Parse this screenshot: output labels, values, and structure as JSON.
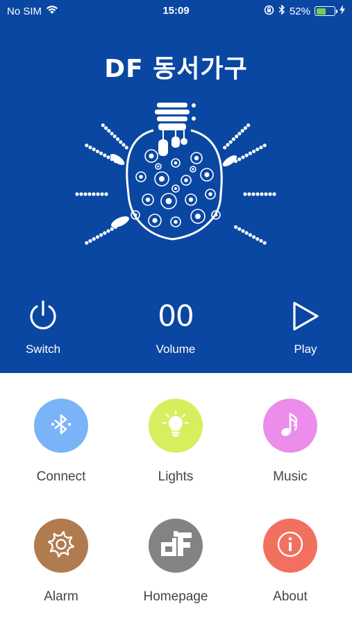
{
  "status_bar": {
    "carrier": "No SIM",
    "time": "15:09",
    "battery_percent": "52%",
    "battery_level": 0.52,
    "icons": [
      "wifi-icon",
      "orientation-lock-icon",
      "bluetooth-icon",
      "battery-icon",
      "charging-icon"
    ]
  },
  "header": {
    "title": "DF 동서가구"
  },
  "controls": {
    "switch_label": "Switch",
    "volume_value": "00",
    "volume_label": "Volume",
    "play_label": "Play"
  },
  "menu": {
    "items": [
      {
        "label": "Connect",
        "icon": "bluetooth-icon",
        "color": "#7ab3f7"
      },
      {
        "label": "Lights",
        "icon": "bulb-icon",
        "color": "#d6ef5e"
      },
      {
        "label": "Music",
        "icon": "music-note-icon",
        "color": "#ec8ceb"
      },
      {
        "label": "Alarm",
        "icon": "gear-icon",
        "color": "#b07b4f"
      },
      {
        "label": "Homepage",
        "icon": "df-logo-icon",
        "color": "#838383"
      },
      {
        "label": "About",
        "icon": "info-icon",
        "color": "#f2705f"
      }
    ]
  },
  "colors": {
    "hero_background": "#0a47a2",
    "text_on_hero": "#ffffff",
    "menu_label": "#444444"
  }
}
